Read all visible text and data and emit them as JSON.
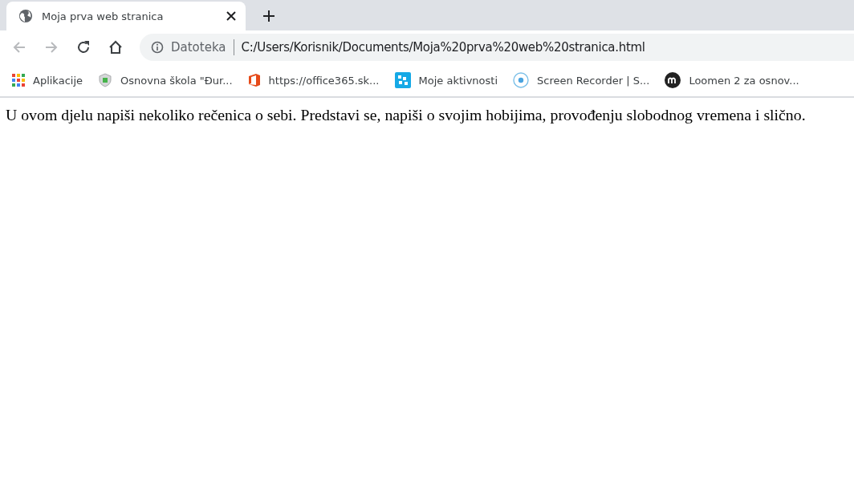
{
  "tabs": [
    {
      "title": "Moja prva web stranica",
      "selected": true
    }
  ],
  "toolbar": {
    "nav": [
      {
        "kind": "back",
        "disabled": true
      },
      {
        "kind": "forward",
        "disabled": true
      },
      {
        "kind": "reload",
        "disabled": false
      },
      {
        "kind": "home",
        "disabled": false
      }
    ],
    "address": {
      "scheme_label": "Datoteka",
      "url": "C:/Users/Korisnik/Documents/Moja%20prva%20web%20stranica.html"
    }
  },
  "bookmarks": [
    {
      "kind": "apps",
      "label": "Aplikacije"
    },
    {
      "kind": "shield",
      "label": "Osnovna škola \"Đur..."
    },
    {
      "kind": "office",
      "label": "https://office365.sk..."
    },
    {
      "kind": "tiles",
      "label": "Moje aktivnosti"
    },
    {
      "kind": "record",
      "label": "Screen Recorder | S..."
    },
    {
      "kind": "m-logo",
      "label": "Loomen 2 za osnov..."
    }
  ],
  "page": {
    "paragraph": "U ovom djelu napiši nekoliko rečenica o sebi. Predstavi se, napiši o svojim hobijima, provođenju slobodnog vremena i slično."
  }
}
